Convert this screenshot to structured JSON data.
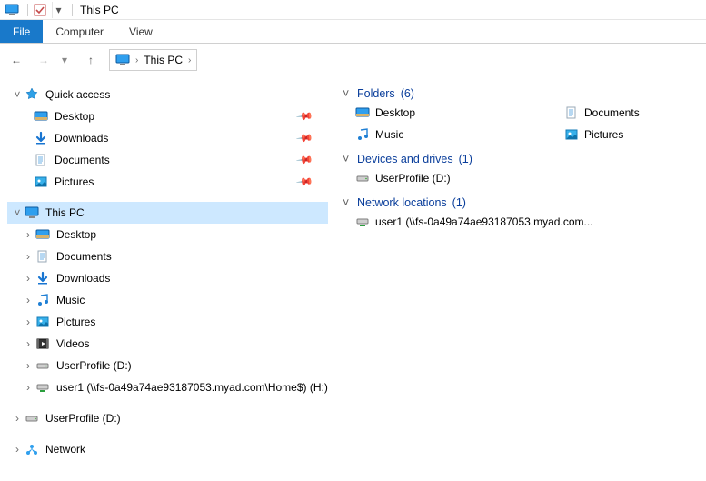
{
  "titlebar": {
    "title": "This PC"
  },
  "ribbon": {
    "file": "File",
    "computer": "Computer",
    "view": "View"
  },
  "address": {
    "location": "This PC"
  },
  "tree": {
    "quick_access": {
      "label": "Quick access",
      "expanded": true
    },
    "qa_items": [
      {
        "label": "Desktop",
        "icon": "desktop",
        "pinned": true
      },
      {
        "label": "Downloads",
        "icon": "downloads",
        "pinned": true
      },
      {
        "label": "Documents",
        "icon": "documents",
        "pinned": true
      },
      {
        "label": "Pictures",
        "icon": "pictures",
        "pinned": true
      }
    ],
    "this_pc": {
      "label": "This PC",
      "expanded": true,
      "selected": true
    },
    "pc_items": [
      {
        "label": "Desktop",
        "icon": "desktop"
      },
      {
        "label": "Documents",
        "icon": "documents"
      },
      {
        "label": "Downloads",
        "icon": "downloads"
      },
      {
        "label": "Music",
        "icon": "music"
      },
      {
        "label": "Pictures",
        "icon": "pictures"
      },
      {
        "label": "Videos",
        "icon": "videos"
      },
      {
        "label": "UserProfile (D:)",
        "icon": "drive"
      },
      {
        "label": "user1 (\\\\fs-0a49a74ae93187053.myad.com\\Home$) (H:)",
        "icon": "netdrive"
      }
    ],
    "root_drive": {
      "label": "UserProfile (D:)",
      "icon": "drive"
    },
    "network": {
      "label": "Network",
      "icon": "network"
    }
  },
  "content": {
    "groups": {
      "folders": {
        "label": "Folders",
        "count": "(6)"
      },
      "devices": {
        "label": "Devices and drives",
        "count": "(1)"
      },
      "netloc": {
        "label": "Network locations",
        "count": "(1)"
      }
    },
    "folders_col1": [
      {
        "label": "Desktop",
        "icon": "desktop"
      },
      {
        "label": "Music",
        "icon": "music"
      }
    ],
    "folders_col2": [
      {
        "label": "Documents",
        "icon": "documents"
      },
      {
        "label": "Pictures",
        "icon": "pictures"
      }
    ],
    "devices": [
      {
        "label": "UserProfile (D:)",
        "icon": "drive"
      }
    ],
    "netloc": [
      {
        "label": "user1 (\\\\fs-0a49a74ae93187053.myad.com...",
        "icon": "netdrive"
      }
    ]
  }
}
